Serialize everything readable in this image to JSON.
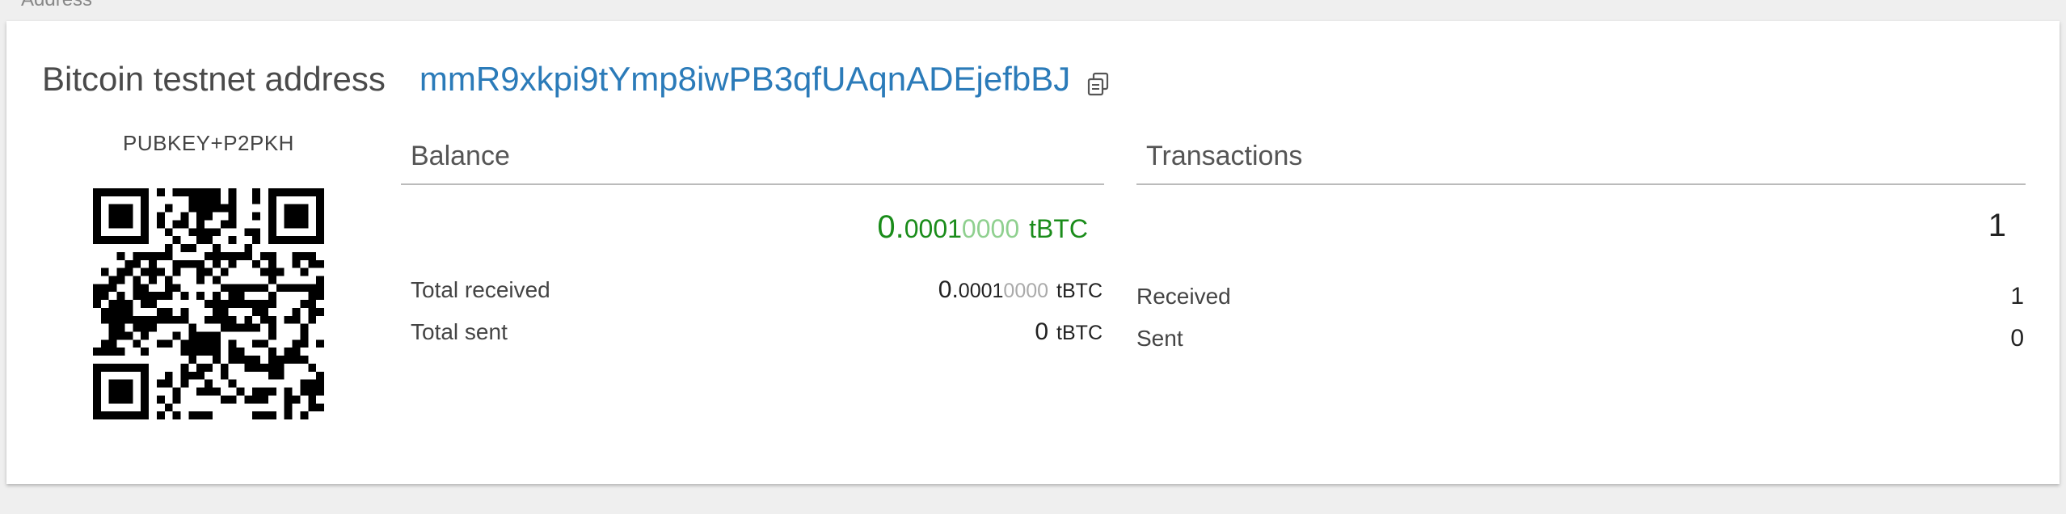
{
  "section": {
    "label": "Address"
  },
  "header": {
    "title": "Bitcoin testnet address",
    "address": "mmR9xkpi9tYmp8iwPB3qfUAqnADEjefbBJ"
  },
  "qr": {
    "type_label": "PUBKEY+P2PKH"
  },
  "balance": {
    "title": "Balance",
    "value_int": "0.",
    "value_sig": "0001",
    "value_fade": "0000",
    "unit": "tBTC",
    "total_received_label": "Total received",
    "total_received_int": "0.",
    "total_received_sig": "0001",
    "total_received_fade": "0000",
    "total_received_unit": "tBTC",
    "total_sent_label": "Total sent",
    "total_sent_value": "0",
    "total_sent_unit": "tBTC"
  },
  "transactions": {
    "title": "Transactions",
    "count": "1",
    "received_label": "Received",
    "received_value": "1",
    "sent_label": "Sent",
    "sent_value": "0"
  },
  "colors": {
    "link": "#2b7bb9",
    "balance_green": "#1a8c1a",
    "balance_green_faded": "#8fd08f"
  }
}
